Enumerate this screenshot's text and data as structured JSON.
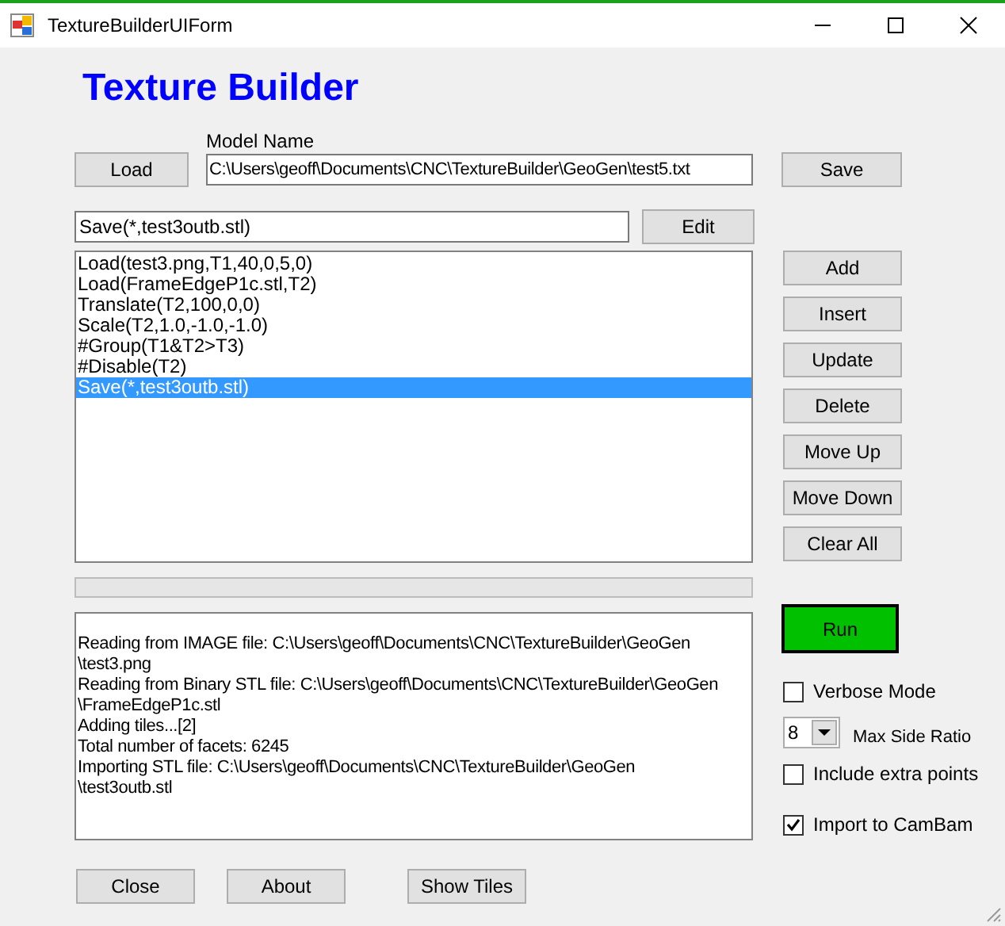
{
  "window": {
    "title": "TextureBuilderUIForm"
  },
  "heading": "Texture Builder",
  "model_name": {
    "label": "Model Name",
    "value": "C:\\Users\\geoff\\Documents\\CNC\\TextureBuilder\\GeoGen\\test5.txt"
  },
  "load_button": "Load",
  "save_button": "Save",
  "command_field": {
    "value": "Save(*,test3outb.stl)"
  },
  "edit_button": "Edit",
  "commands": [
    {
      "text": "Load(test3.png,T1,40,0,5,0)",
      "selected": false
    },
    {
      "text": "Load(FrameEdgeP1c.stl,T2)",
      "selected": false
    },
    {
      "text": "Translate(T2,100,0,0)",
      "selected": false
    },
    {
      "text": "Scale(T2,1.0,-1.0,-1.0)",
      "selected": false
    },
    {
      "text": "#Group(T1&T2>T3)",
      "selected": false
    },
    {
      "text": "#Disable(T2)",
      "selected": false
    },
    {
      "text": "Save(*,test3outb.stl)",
      "selected": true
    }
  ],
  "side_buttons": [
    "Add",
    "Insert",
    "Update",
    "Delete",
    "Move Up",
    "Move Down",
    "Clear All"
  ],
  "progress": {
    "level": 0
  },
  "log": [
    "Reading from IMAGE file: C:\\Users\\geoff\\Documents\\CNC\\TextureBuilder\\GeoGen",
    "\\test3.png",
    "Reading from Binary STL file: C:\\Users\\geoff\\Documents\\CNC\\TextureBuilder\\GeoGen",
    "\\FrameEdgeP1c.stl",
    "Adding tiles...[2]",
    "Total number of facets: 6245",
    "Importing STL file: C:\\Users\\geoff\\Documents\\CNC\\TextureBuilder\\GeoGen",
    "\\test3outb.stl"
  ],
  "run_button": "Run",
  "verbose_mode": {
    "label": "Verbose Mode",
    "checked": false
  },
  "max_side_ratio": {
    "value": "8",
    "label": "Max Side Ratio"
  },
  "options": [
    {
      "label": "Include extra points",
      "checked": false
    },
    {
      "label": "Import to CamBam",
      "checked": true
    }
  ],
  "bottom_buttons": [
    "Close",
    "About",
    "Show Tiles"
  ]
}
